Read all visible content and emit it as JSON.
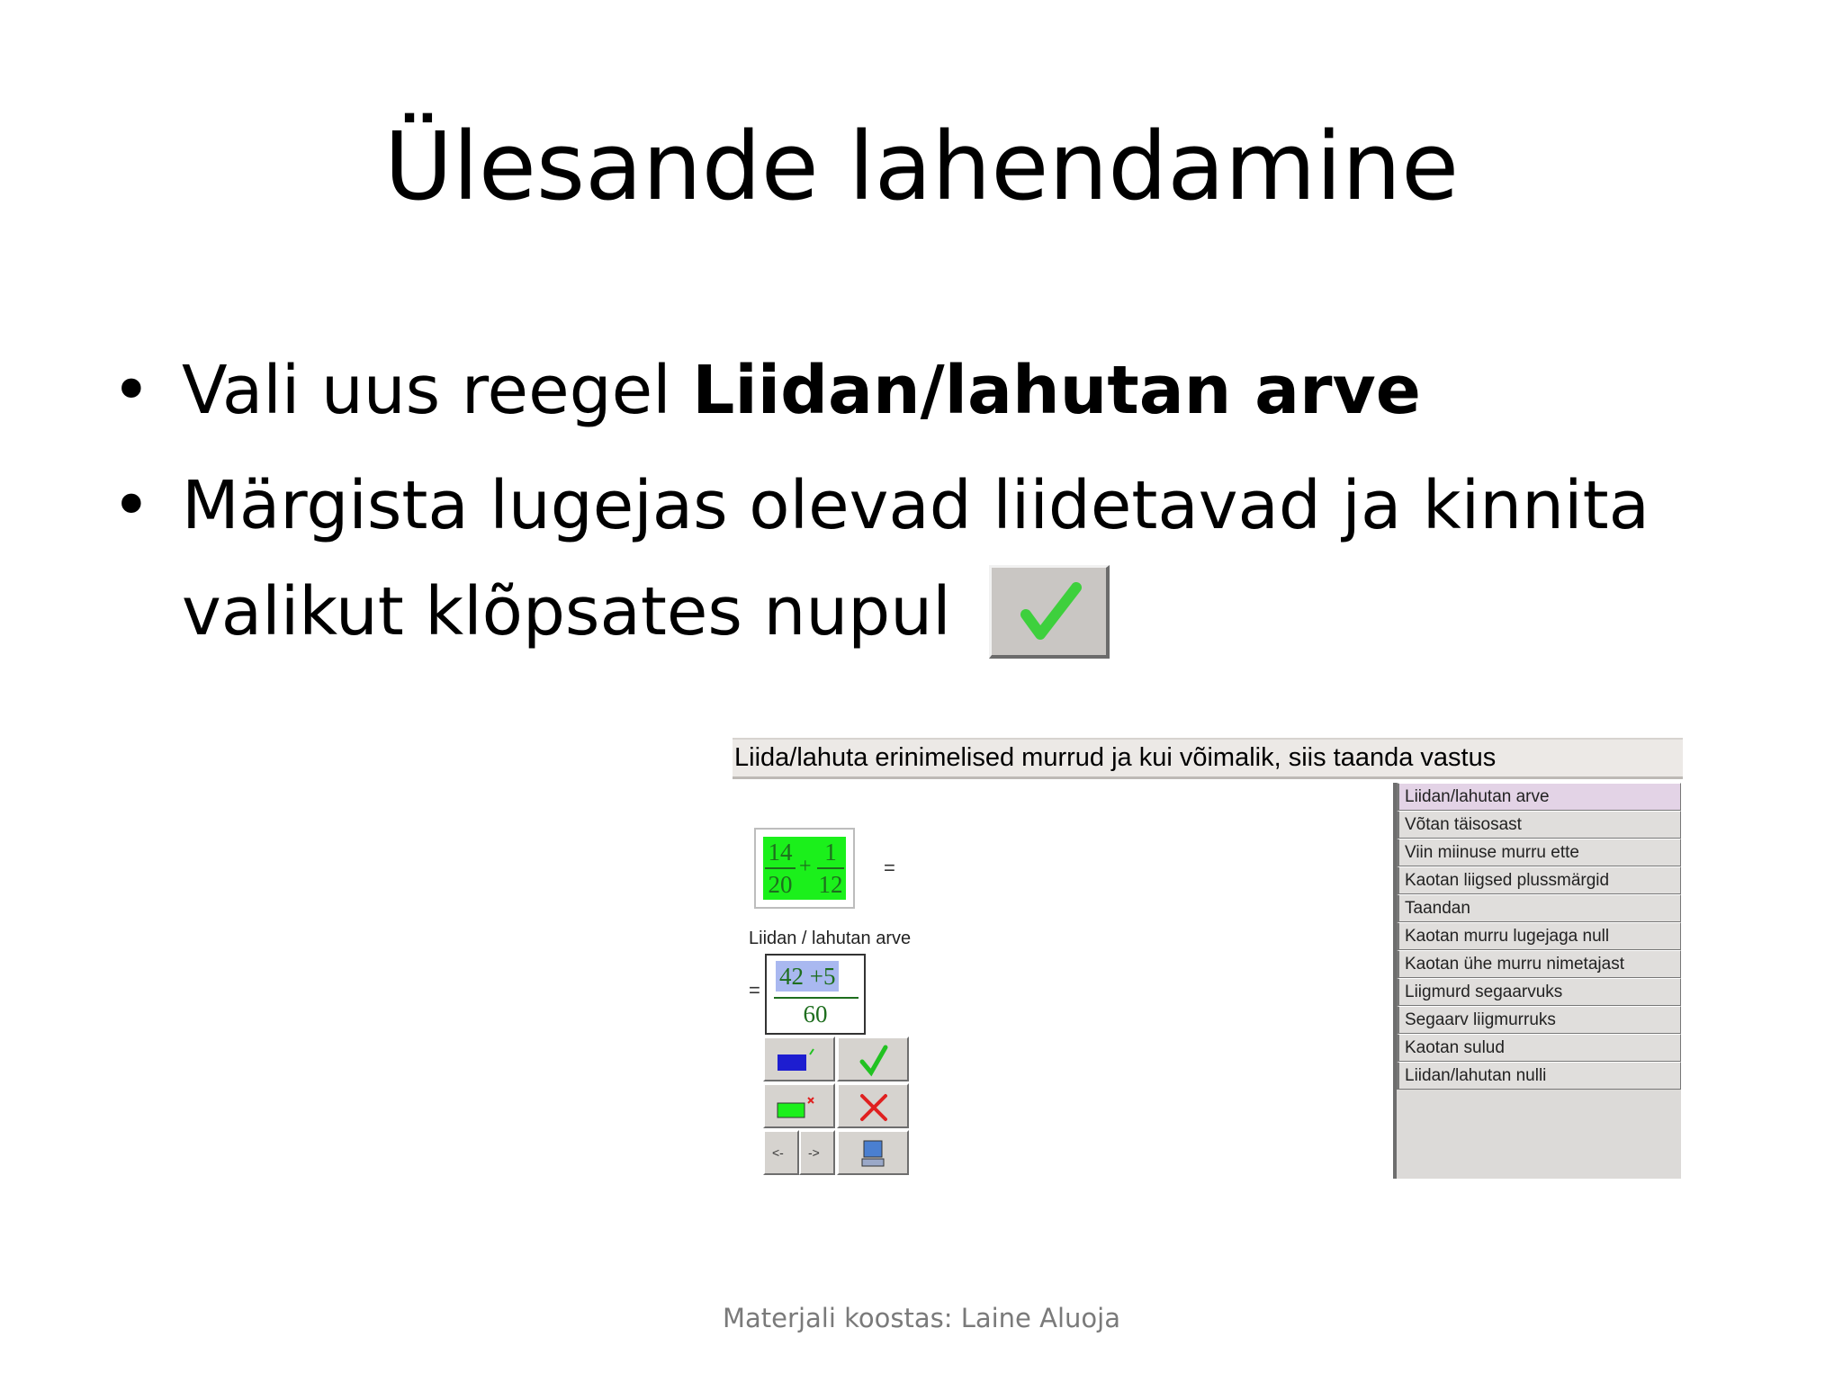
{
  "slide": {
    "title": "Ülesande lahendamine",
    "bullet1_prefix": "Vali uus reegel ",
    "bullet1_bold": "Liidan/lahutan arve",
    "bullet2": "Märgista lugejas olevad liidetavad ja kinnita valikut klõpsates nupul",
    "footer": "Materjali koostas: Laine Aluoja"
  },
  "app": {
    "task": "Liida/lahuta erinimelised murrud ja kui võimalik, siis taanda vastus",
    "expression": {
      "frac1_num": "14",
      "frac1_den": "20",
      "plus": "+",
      "frac2_num": "1",
      "frac2_den": "12",
      "equals": "="
    },
    "rule_caption": "Liidan / lahutan arve",
    "answer": {
      "equals": "=",
      "numerator": "42 +5",
      "denominator": "60"
    },
    "tools": {
      "prev": "<-",
      "next": "->"
    },
    "rules": [
      "Liidan/lahutan arve",
      "Võtan täisosast",
      "Viin miinuse murru ette",
      "Kaotan liigsed plussmärgid",
      "Taandan",
      "Kaotan murru lugejaga null",
      "Kaotan ühe murru nimetajast",
      "Liigmurd segaarvuks",
      "Segaarv liigmurruks",
      "Kaotan sulud",
      "Liidan/lahutan nulli"
    ],
    "selected_rule": 0
  },
  "colors": {
    "expression_bg": "#1bf01b",
    "selection_highlight": "#a9b8f0",
    "selected_rule_bg": "#e3d3e6",
    "check_green": "#22c222",
    "cross_red": "#e02020"
  }
}
